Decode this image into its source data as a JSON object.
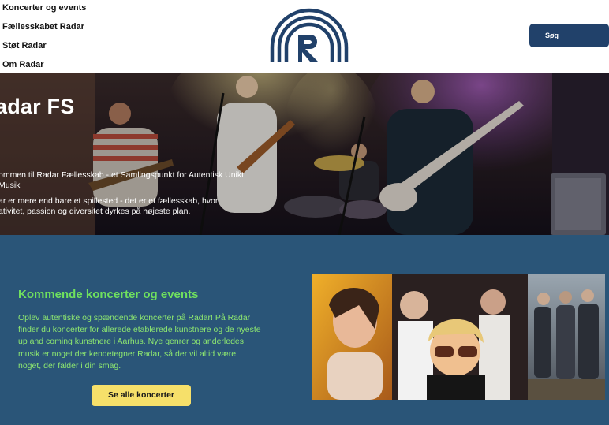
{
  "header": {
    "nav": [
      {
        "label": "Koncerter og events"
      },
      {
        "label": "Fællesskabet Radar"
      },
      {
        "label": "Støt Radar"
      },
      {
        "label": "Om Radar"
      }
    ],
    "logo_icon": "radar-rainbow-logo-icon",
    "search_label": "Søg"
  },
  "hero": {
    "title": "adar FS",
    "subtitle": "ommen til Radar Fællesskab - et Samlingspunkt for Autentisk Unikt Musik",
    "description": "ar er mere end bare et spillested - det er et fællesskab, hvor ativitet, passion og diversitet dyrkes på højeste plan."
  },
  "events": {
    "title": "Kommende koncerter og events",
    "body": "Oplev autentiske og spændende koncerter på Radar! På Radar finder du koncerter for allerede etablerede kunstnere og de nyeste up and coming kunstnere i Aarhus. Nye genrer og anderledes musik er noget der kendetegner Radar, så der vil altid være noget, der falder i din smag.",
    "button_label": "Se alle koncerter"
  },
  "colors": {
    "navy": "#21416a",
    "events_bg": "#2a5578",
    "accent_green": "#6fe05e",
    "button_yellow": "#f6e06a"
  }
}
